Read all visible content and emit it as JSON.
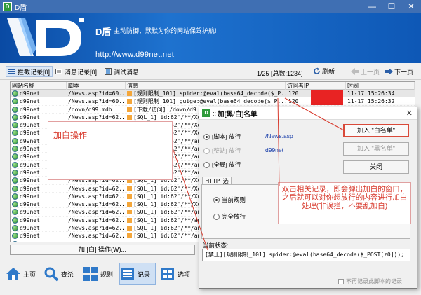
{
  "window": {
    "title": "D盾",
    "min": "—",
    "max": "☐",
    "close": "✕"
  },
  "banner": {
    "brand": "D盾",
    "slogan": "主动防御，默默为你的网站保驾护航!",
    "website": "http://www.d99net.net"
  },
  "toolbar": {
    "tabs": [
      {
        "label": "拦截记录[0]"
      },
      {
        "label": "消息记录[0]"
      },
      {
        "label": "调试消息"
      }
    ],
    "page_info": "1/25 [总数:1234]",
    "refresh": "刷新",
    "prev": "上一页",
    "next": "下一页"
  },
  "table": {
    "headers": [
      "网站名称",
      "脚本",
      "信息",
      "访问者IP",
      "时间"
    ],
    "rows": [
      {
        "site": "d99net",
        "script": "/News.asp?id=60...",
        "info": "[规则限制_101] spider:@eval(base64_decode($_P...",
        "ip": "120",
        "time": "11-17 15:26:34",
        "sel": true
      },
      {
        "site": "d99net",
        "script": "/News.asp?id=60...",
        "info": "[规则限制_101] guige:@eval(base64_decode($_P...",
        "ip": "120",
        "time": "11-17 15:26:32",
        "sel": false
      },
      {
        "site": "d99net",
        "script": "/down/d99.mdb",
        "info": "[下载/访问] /down/d9",
        "ip": "",
        "time": "",
        "sel": false
      },
      {
        "site": "d99net",
        "script": "/News.asp?id=62...",
        "info": "[SQL_1] id:62'/**/Xo",
        "ip": "",
        "time": "",
        "sel": false
      },
      {
        "site": "d99net",
        "script": "/News.asp?id=62...",
        "info": "[SQL_1] id:62'/**/Xo",
        "ip": "",
        "time": "",
        "sel": false
      },
      {
        "site": "d99net",
        "script": "/News.asp?id=62...",
        "info": "[SQL_1] id:62'/**/Xo",
        "ip": "",
        "time": "",
        "sel": false
      },
      {
        "site": "d99net",
        "script": "/News.asp?id=62...",
        "info": "[SQL_1] id:62'/**/an",
        "ip": "",
        "time": "",
        "sel": false
      },
      {
        "site": "d99net",
        "script": "/News.asp?id=62...",
        "info": "[SQL_1] id:62'/**/an",
        "ip": "",
        "time": "",
        "sel": false
      },
      {
        "site": "d99net",
        "script": "/News.asp?id=62...",
        "info": "[SQL_1] id:62'/**/an",
        "ip": "",
        "time": "",
        "sel": false
      },
      {
        "site": "d99net",
        "script": "/News.asp?id=62...",
        "info": "[SQL_1] id:62'/**/an",
        "ip": "",
        "time": "",
        "sel": false
      },
      {
        "site": "d99net",
        "script": "/News.asp?id=62...",
        "info": "[SQL_1] id:62'/**/an",
        "ip": "",
        "time": "",
        "sel": false
      },
      {
        "site": "d99net",
        "script": "/News.asp?id=62...",
        "info": "[SQL_1] id:62'/**/Xo",
        "ip": "",
        "time": "",
        "sel": false
      },
      {
        "site": "d99net",
        "script": "/News.asp?id=62...",
        "info": "[SQL_1] id:62'/**/Xo",
        "ip": "",
        "time": "",
        "sel": false
      },
      {
        "site": "d99net",
        "script": "/News.asp?id=62...",
        "info": "[SQL_1] id:62'/**/Xo",
        "ip": "",
        "time": "",
        "sel": false
      },
      {
        "site": "d99net",
        "script": "/News.asp?id=62...",
        "info": "[SQL_1] id:62'/**/Xo",
        "ip": "",
        "time": "",
        "sel": false
      },
      {
        "site": "d99net",
        "script": "/News.asp?id=62...",
        "info": "[SQL_1] id:62'/**/an",
        "ip": "",
        "time": "",
        "sel": false
      },
      {
        "site": "d99net",
        "script": "/News.asp?id=62...",
        "info": "[SQL_1] id:62'/**/an",
        "ip": "",
        "time": "",
        "sel": false
      },
      {
        "site": "d99net",
        "script": "/News.asp?id=62...",
        "info": "[SQL_1] id:62'/**/an",
        "ip": "",
        "time": "",
        "sel": false
      },
      {
        "site": "d99net",
        "script": "/News.asp?id=62...",
        "info": "[SQL_1] id:62'/**/an",
        "ip": "",
        "time": "",
        "sel": false
      },
      {
        "site": "d99net",
        "script": "/News.asp?id=62...",
        "info": "[SQL_1] id:62'/**/Xo",
        "ip": "",
        "time": "",
        "sel": false
      }
    ]
  },
  "whitelist_button": "加 [白] 操作(W)...",
  "nav": [
    {
      "label": "主页",
      "icon": "home-icon"
    },
    {
      "label": "查杀",
      "icon": "search-icon"
    },
    {
      "label": "规则",
      "icon": "grid-icon"
    },
    {
      "label": "记录",
      "icon": "record-icon"
    },
    {
      "label": "选项",
      "icon": "options-icon"
    }
  ],
  "annotation_left": "加白操作",
  "dialog": {
    "title": "加[黑/白]名单",
    "close": "✕",
    "options": [
      {
        "label": "[脚本] 放行",
        "value": "/News.asp",
        "checked": true,
        "disabled": false
      },
      {
        "label": "[整站] 放行",
        "value": "d99net",
        "checked": false,
        "disabled": true
      },
      {
        "label": "[全局] 放行",
        "value": "",
        "checked": false,
        "disabled": false
      }
    ],
    "buttons": {
      "add_white": "加入 \"白名单\"",
      "add_black": "加入 \"黑名单\"",
      "close": "关闭"
    },
    "http_tab": "HTTP_选项",
    "http_options": [
      {
        "label": "当前规则",
        "checked": true
      },
      {
        "label": "完全放行",
        "checked": false
      }
    ],
    "status_label": "当前状态:",
    "status_value": "[禁止][规则限制_101] spider:@eval(base64_decode($_POST[z0]));",
    "no_record": "不再记录此脚本的记录"
  },
  "annotation_right": "双击相关记录，即会弹出加白的窗口，之后就可以对你想放行的内容进行加白处理(非误拦，不要乱加白)"
}
